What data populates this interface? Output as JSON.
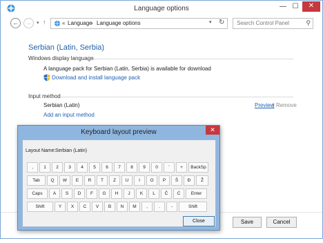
{
  "window": {
    "title": "Language options",
    "minimize": "—",
    "maximize": "☐",
    "close": "✕"
  },
  "navbar": {
    "back": "←",
    "forward": "→",
    "recent": "▾",
    "up": "↑",
    "breadcrumb_prefix": "«",
    "crumbs": [
      "Language",
      "Language options"
    ],
    "separator": "›",
    "dropdown": "▾",
    "refresh": "↻",
    "search_placeholder": "Search Control Panel",
    "search_icon": "⚲"
  },
  "content": {
    "page_title": "Serbian (Latin, Serbia)",
    "display_section": "Windows display language",
    "pack_message": "A language pack for Serbian (Latin, Serbia) is available for download",
    "download_link": "Download and install language pack",
    "input_section": "Input method",
    "input_method": "Serbian (Latin)",
    "preview_link": "Preview",
    "pipe": "|",
    "remove_link": "Remove",
    "add_input_link": "Add an input method"
  },
  "footer": {
    "save": "Save",
    "cancel": "Cancel"
  },
  "dialog": {
    "title": "Keyboard layout preview",
    "close": "✕",
    "layout_label": "Layout Name:",
    "layout_value": "Serbian (Latin)",
    "close_button": "Close",
    "rows": [
      [
        ",",
        "1",
        "2",
        "3",
        "4",
        "5",
        "6",
        "7",
        "8",
        "9",
        "0",
        "'",
        "+",
        "BackSp"
      ],
      [
        "Tab",
        "Q",
        "W",
        "E",
        "R",
        "T",
        "Z",
        "U",
        "I",
        "O",
        "P",
        "Š",
        "Đ",
        "Ž"
      ],
      [
        "Caps",
        "A",
        "S",
        "D",
        "F",
        "G",
        "H",
        "J",
        "K",
        "L",
        "Č",
        "Ć",
        "Enter"
      ],
      [
        "Shift",
        "Y",
        "X",
        "C",
        "V",
        "B",
        "N",
        "M",
        ",",
        ".",
        "-",
        "Shift"
      ]
    ]
  },
  "colors": {
    "accent": "#1e5fa5",
    "link": "#1f5fb3",
    "close_red": "#c7383d",
    "dialog_frame": "#8fb6df"
  }
}
